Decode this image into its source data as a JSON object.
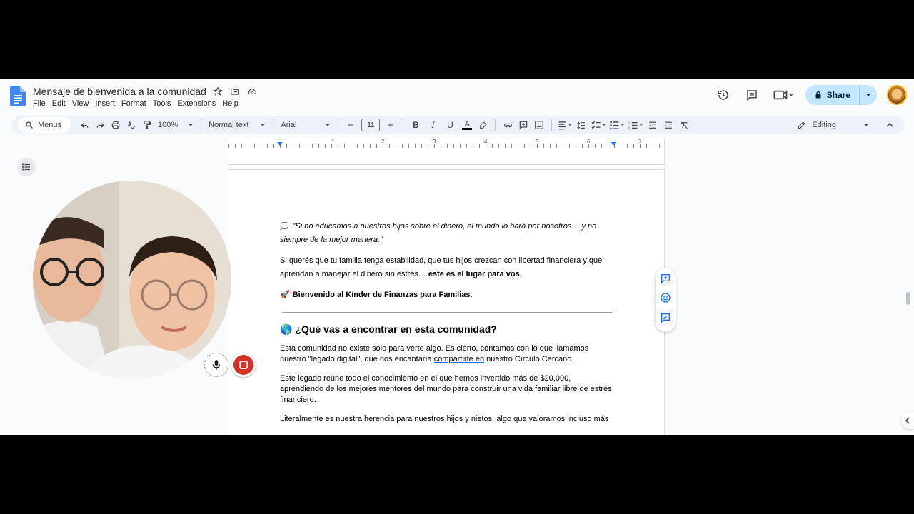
{
  "header": {
    "doc_title": "Mensaje de bienvenida a la comunidad",
    "menu": [
      "File",
      "Edit",
      "View",
      "Insert",
      "Format",
      "Tools",
      "Extensions",
      "Help"
    ],
    "share_label": "Share",
    "icons": [
      "history-icon",
      "comment-icon",
      "meet-icon",
      "lock-icon"
    ]
  },
  "toolbar": {
    "menus_label": "Menus",
    "zoom": "100%",
    "style": "Normal text",
    "font": "Arial",
    "font_size": "11",
    "mode": "Editing"
  },
  "ruler": {
    "numbers": [
      "1",
      "2",
      "3",
      "4",
      "5",
      "6",
      "7"
    ]
  },
  "document": {
    "quote_line1": "\"Si no educamos a nuestros hijos sobre el dinero, el mundo lo hará por nosotros… y no",
    "quote_line2": "siempre de la mejor manera.\"",
    "para1_a": "Si querés que tu familia tenga estabilidad, que tus hijos crezcan con libertad financiera y que",
    "para1_b": "aprendan a manejar el dinero sin estrés… ",
    "para1_bold": "este es el lugar para vos.",
    "welcome_emoji": "🚀",
    "welcome": "Bienvenido al Kínder de Finanzas para Familias.",
    "heading_emoji": "🌎",
    "heading": "¿Qué vas a encontrar en esta comunidad?",
    "para2_a": "Esta comunidad no existe solo para verte algo. Es cierto, contamos con lo que llamamos",
    "para2_b": "nuestro \"legado digital\", que nos encantaría ",
    "para2_link": "compartirte en",
    "para2_c": " nuestro Círculo Cercano.",
    "para3": "Este legado reúne todo el conocimiento en el que hemos invertido más de $20,000, aprendiendo de los mejores mentores del mundo para construir una vida familiar libre de estrés financiero.",
    "para4": "Literalmente es nuestra herencia para nuestros hijos y nietos, algo que valoramos incluso más"
  },
  "colors": {
    "accent": "#1a73e8",
    "share_bg": "#c2e7ff",
    "record_red": "#d93025"
  }
}
